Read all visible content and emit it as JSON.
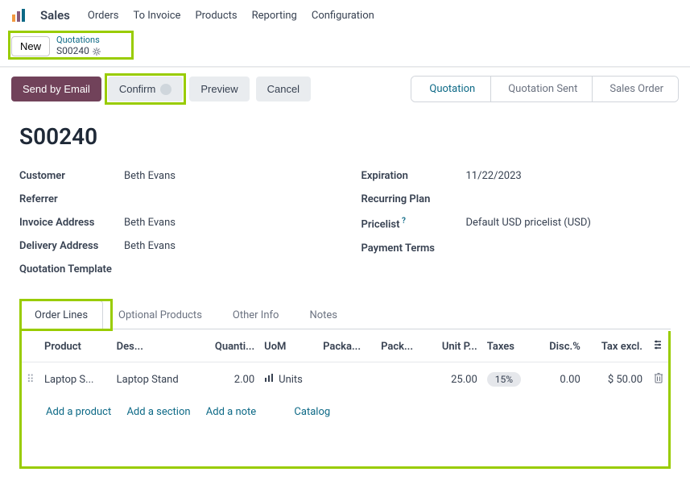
{
  "nav": {
    "brand": "Sales",
    "items": [
      "Orders",
      "To Invoice",
      "Products",
      "Reporting",
      "Configuration"
    ]
  },
  "breadcrumb": {
    "new_label": "New",
    "parent": "Quotations",
    "current": "S00240"
  },
  "actions": {
    "send_email": "Send by Email",
    "confirm": "Confirm",
    "preview": "Preview",
    "cancel": "Cancel"
  },
  "status_steps": [
    "Quotation",
    "Quotation Sent",
    "Sales Order"
  ],
  "record": {
    "title": "S00240",
    "left": {
      "customer_label": "Customer",
      "customer": "Beth Evans",
      "referrer_label": "Referrer",
      "referrer": "",
      "invoice_addr_label": "Invoice Address",
      "invoice_addr": "Beth Evans",
      "delivery_addr_label": "Delivery Address",
      "delivery_addr": "Beth Evans",
      "template_label": "Quotation Template",
      "template": ""
    },
    "right": {
      "expiration_label": "Expiration",
      "expiration": "11/22/2023",
      "recurring_label": "Recurring Plan",
      "recurring": "",
      "pricelist_label": "Pricelist",
      "pricelist": "Default USD pricelist (USD)",
      "terms_label": "Payment Terms",
      "terms": ""
    }
  },
  "tabs": [
    "Order Lines",
    "Optional Products",
    "Other Info",
    "Notes"
  ],
  "table": {
    "headers": {
      "product": "Product",
      "desc": "Des...",
      "qty": "Quanti...",
      "uom": "UoM",
      "packa1": "Packa...",
      "packa2": "Pack...",
      "unitp": "Unit P...",
      "taxes": "Taxes",
      "disc": "Disc.%",
      "taxexcl": "Tax excl."
    },
    "row": {
      "product": "Laptop S...",
      "desc": "Laptop Stand",
      "qty": "2.00",
      "uom": "Units",
      "unit_price": "25.00",
      "tax": "15%",
      "disc": "0.00",
      "tax_excl": "$ 50.00"
    },
    "add": {
      "product": "Add a product",
      "section": "Add a section",
      "note": "Add a note",
      "catalog": "Catalog"
    }
  }
}
